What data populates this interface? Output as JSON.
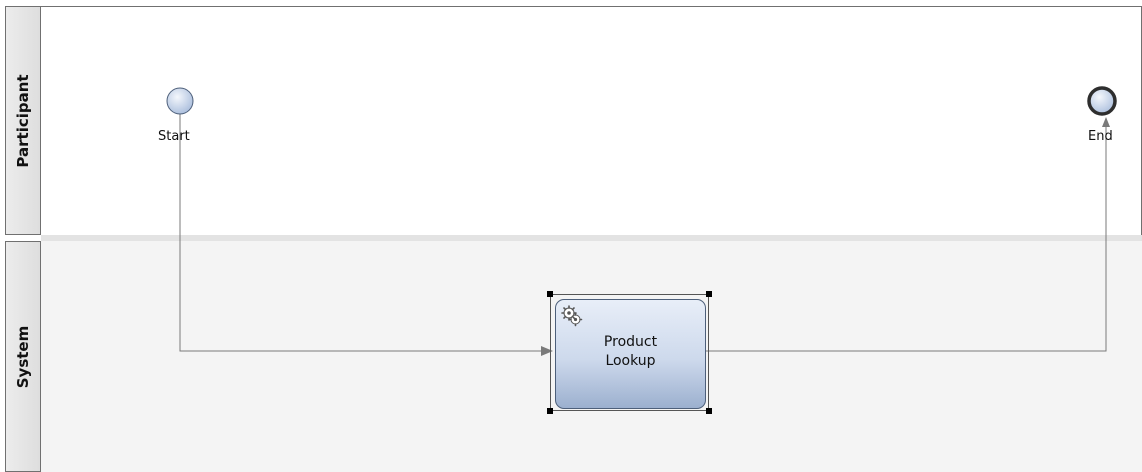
{
  "lanes": [
    {
      "name": "Participant"
    },
    {
      "name": "System"
    }
  ],
  "events": {
    "start": {
      "label": "Start"
    },
    "end": {
      "label": "End"
    }
  },
  "task": {
    "label_line1": "Product",
    "label_line2": "Lookup",
    "icon": "gears-icon"
  },
  "colors": {
    "event_fill": "#c8d6ec",
    "task_fill": "#cdd9ec",
    "connector": "#777777",
    "lane_header": "#e4e4e4"
  }
}
